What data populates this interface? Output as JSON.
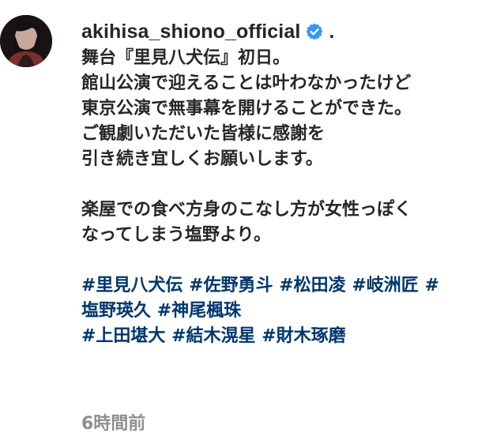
{
  "post": {
    "username": "akihisa_shiono_official",
    "verified_icon": "verified-badge-icon",
    "separator": ".",
    "caption_lines": [
      "舞台『里見八犬伝』初日。",
      "館山公演で迎えることは叶わなかったけど",
      "東京公演で無事幕を開けることができた。",
      "ご観劇いただいた皆様に感謝を",
      "引き続き宜しくお願いします。"
    ],
    "caption_lines_2": [
      "楽屋での食べ方身のこなし方が女性っぽく",
      "なってしまう塩野より。"
    ],
    "hashtags": {
      "row1": [
        "#里見八犬伝",
        "#佐野勇斗",
        "#松田凌",
        "#岐洲匠",
        "#"
      ],
      "row2": [
        "塩野瑛久",
        "#神尾楓珠"
      ],
      "row3": [
        "#上田堪大",
        "#結木滉星",
        "#財木琢磨"
      ]
    },
    "timestamp": "6時間前",
    "colors": {
      "text": "#262626",
      "hashtag": "#00376b",
      "verified": "#3897f0",
      "timestamp": "#8e8e8e"
    }
  }
}
